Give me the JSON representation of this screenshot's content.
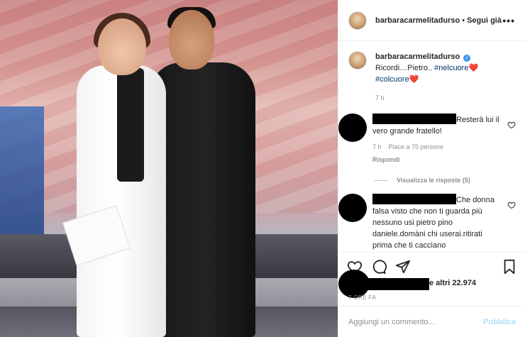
{
  "header": {
    "username": "barbaracarmelitadurso",
    "separator": "•",
    "follow_label": "Segui già",
    "more_label": "•••"
  },
  "caption": {
    "username": "barbaracarmelitadurso",
    "text": "Ricordi…Pietro..",
    "hashtag1": "#nelcuore",
    "hashtag2": "#colcuore",
    "heart": "❤️",
    "time": "7 h"
  },
  "comments": [
    {
      "text": "Resterà lui il vero grande fratello!",
      "time": "7 h",
      "likes": "Piace a 75 persone",
      "reply_label": "Rispondi",
      "view_replies_label": "Visualizza le risposte (5)"
    },
    {
      "text": "Che donna falsa visto che non ti guarda più nessuno usi pietro pino daniele.domàni chi userai.ritirati prima che ti cacciano"
    }
  ],
  "likes": {
    "text": "e altri 22.974",
    "time_ago": "7 ORE FA"
  },
  "add_comment": {
    "placeholder": "Aggiungi un commento...",
    "publish_label": "Pubblica"
  },
  "colors": {
    "link": "#00376b",
    "verified": "#3897f0",
    "publish_disabled": "#b2dffc"
  }
}
